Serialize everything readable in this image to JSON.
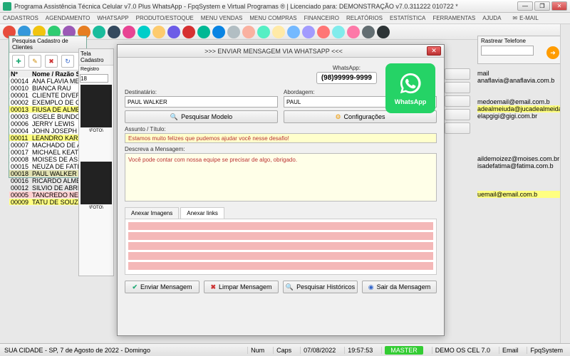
{
  "window": {
    "title": "Programa Assistência Técnica Celular v7.0 Plus WhatsApp - FpqSystem e Virtual Programas ® | Licenciado para: DEMONSTRAÇÃO v7.0.311222 010722 *"
  },
  "menu": [
    "CADASTROS",
    "AGENDAMENTO",
    "WHATSAPP",
    "PRODUTO/ESTOQUE",
    "MENU VENDAS",
    "MENU COMPRAS",
    "FINANCEIRO",
    "RELATÓRIOS",
    "ESTATÍSTICA",
    "FERRAMENTAS",
    "AJUDA"
  ],
  "menu_email": "E-MAIL",
  "leftpanel": {
    "title": "Pesquisa Cadastro de Clientes",
    "headers": {
      "num": "Nº",
      "name": "Nome / Razão Social"
    },
    "rows": [
      {
        "n": "00014",
        "name": "ANA FLAVIA MEIRELLES",
        "cls": ""
      },
      {
        "n": "00010",
        "name": "BIANCA RAU",
        "cls": ""
      },
      {
        "n": "00001",
        "name": "CLIENTE DIVERSOS",
        "cls": ""
      },
      {
        "n": "00002",
        "name": "EXEMPLO DE CLIENTE",
        "cls": ""
      },
      {
        "n": "00013",
        "name": "FIUSA DE ALMEIDA JUCA",
        "cls": "yellow"
      },
      {
        "n": "00003",
        "name": "GISELE BUNDCHEN",
        "cls": ""
      },
      {
        "n": "00006",
        "name": "JERRY LEWIS",
        "cls": ""
      },
      {
        "n": "00004",
        "name": "JOHN JOSEPH TRAVOLTA",
        "cls": ""
      },
      {
        "n": "00011",
        "name": "LEANDRO KARNAL",
        "cls": "yellow"
      },
      {
        "n": "00007",
        "name": "MACHADO DE ASSIS",
        "cls": ""
      },
      {
        "n": "00017",
        "name": "MICHAEL KEATON",
        "cls": ""
      },
      {
        "n": "00008",
        "name": "MOISES DE ASSIS",
        "cls": ""
      },
      {
        "n": "00015",
        "name": "NEUZA DE FATIMA DA SI",
        "cls": ""
      },
      {
        "n": "00018",
        "name": "PAUL WALKER",
        "cls": "sel"
      },
      {
        "n": "00016",
        "name": "RICARDO ALMEIDA",
        "cls": ""
      },
      {
        "n": "00012",
        "name": "SILVIO DE ABREU",
        "cls": ""
      },
      {
        "n": "00005",
        "name": "TANCREDO NEVES",
        "cls": "pink"
      },
      {
        "n": "00009",
        "name": "TATU DE SOUZA",
        "cls": "yellow"
      }
    ]
  },
  "tela": {
    "title": "Tela Cadastro",
    "registro": "Registro",
    "reg_val": "18",
    "foto": "\\FOTO\\",
    "foto2": "\\FOTO\\"
  },
  "rightbox": {
    "label": "Rastrear Telefone",
    "value": ""
  },
  "emails": [
    {
      "t": "mail",
      "cls": ""
    },
    {
      "t": "anaflavia@anaflavia.com.b",
      "cls": ""
    },
    {
      "t": "",
      "cls": ""
    },
    {
      "t": "",
      "cls": ""
    },
    {
      "t": "medoemail@email.com.b",
      "cls": ""
    },
    {
      "t": "adealmeiuda@jucadealmeida.com.br",
      "cls": "y"
    },
    {
      "t": "elapgigi@gigi.com.br",
      "cls": ""
    },
    {
      "t": "",
      "cls": ""
    },
    {
      "t": "",
      "cls": ""
    },
    {
      "t": "",
      "cls": ""
    },
    {
      "t": "",
      "cls": ""
    },
    {
      "t": "",
      "cls": ""
    },
    {
      "t": "aildemoizez@moises.com.br",
      "cls": ""
    },
    {
      "t": "isadefatima@fatima.com.b",
      "cls": ""
    },
    {
      "t": "",
      "cls": ""
    },
    {
      "t": "",
      "cls": ""
    },
    {
      "t": "",
      "cls": ""
    },
    {
      "t": "uemail@email.com.b",
      "cls": "y"
    }
  ],
  "modal": {
    "title": ">>>  ENVIAR MENSAGEM VIA WHATSAPP  <<<",
    "wa_label": "WhatsApp:",
    "wa_number": "(98)99999-9999",
    "wa_brand": "WhatsApp",
    "dest_label": "Destinatário:",
    "dest_value": "PAUL WALKER",
    "abord_label": "Abordagem:",
    "abord_value": "PAUL",
    "pesq_modelo": "Pesquisar Modelo",
    "config": "Configurações",
    "assunto_label": "Assunto / Título:",
    "assunto_value": "Estamos muito felizes que pudemos ajudar você nesse desafio!",
    "desc_label": "Descreva a Mensagem:",
    "desc_value": "Você pode contar com nossa equipe se precisar de algo, obrigado.",
    "tab1": "Anexar Imagens",
    "tab2": "Anexar links",
    "btn_enviar": "Enviar Mensagem",
    "btn_limpar": "Limpar Mensagem",
    "btn_hist": "Pesquisar Históricos",
    "btn_sair": "Sair da Mensagem"
  },
  "status": {
    "left": "SUA CIDADE - SP, 7 de Agosto de 2022 - Domingo",
    "num": "Num",
    "caps": "Caps",
    "date": "07/08/2022",
    "time": "19:57:53",
    "master": "MASTER",
    "demo": "DEMO OS CEL 7.0",
    "email": "Email",
    "sys": "FpqSystem"
  },
  "toolbar_colors": [
    "#e74c3c",
    "#3498db",
    "#f1c40f",
    "#2ecc71",
    "#9b59b6",
    "#e67e22",
    "#1abc9c",
    "#34495e",
    "#e84393",
    "#00cec9",
    "#fdcb6e",
    "#6c5ce7",
    "#d63031",
    "#00b894",
    "#0984e3",
    "#b2bec3",
    "#fab1a0",
    "#55efc4",
    "#ffeaa7",
    "#74b9ff",
    "#a29bfe",
    "#ff7675",
    "#81ecec",
    "#fd79a8",
    "#636e72",
    "#2d3436"
  ]
}
